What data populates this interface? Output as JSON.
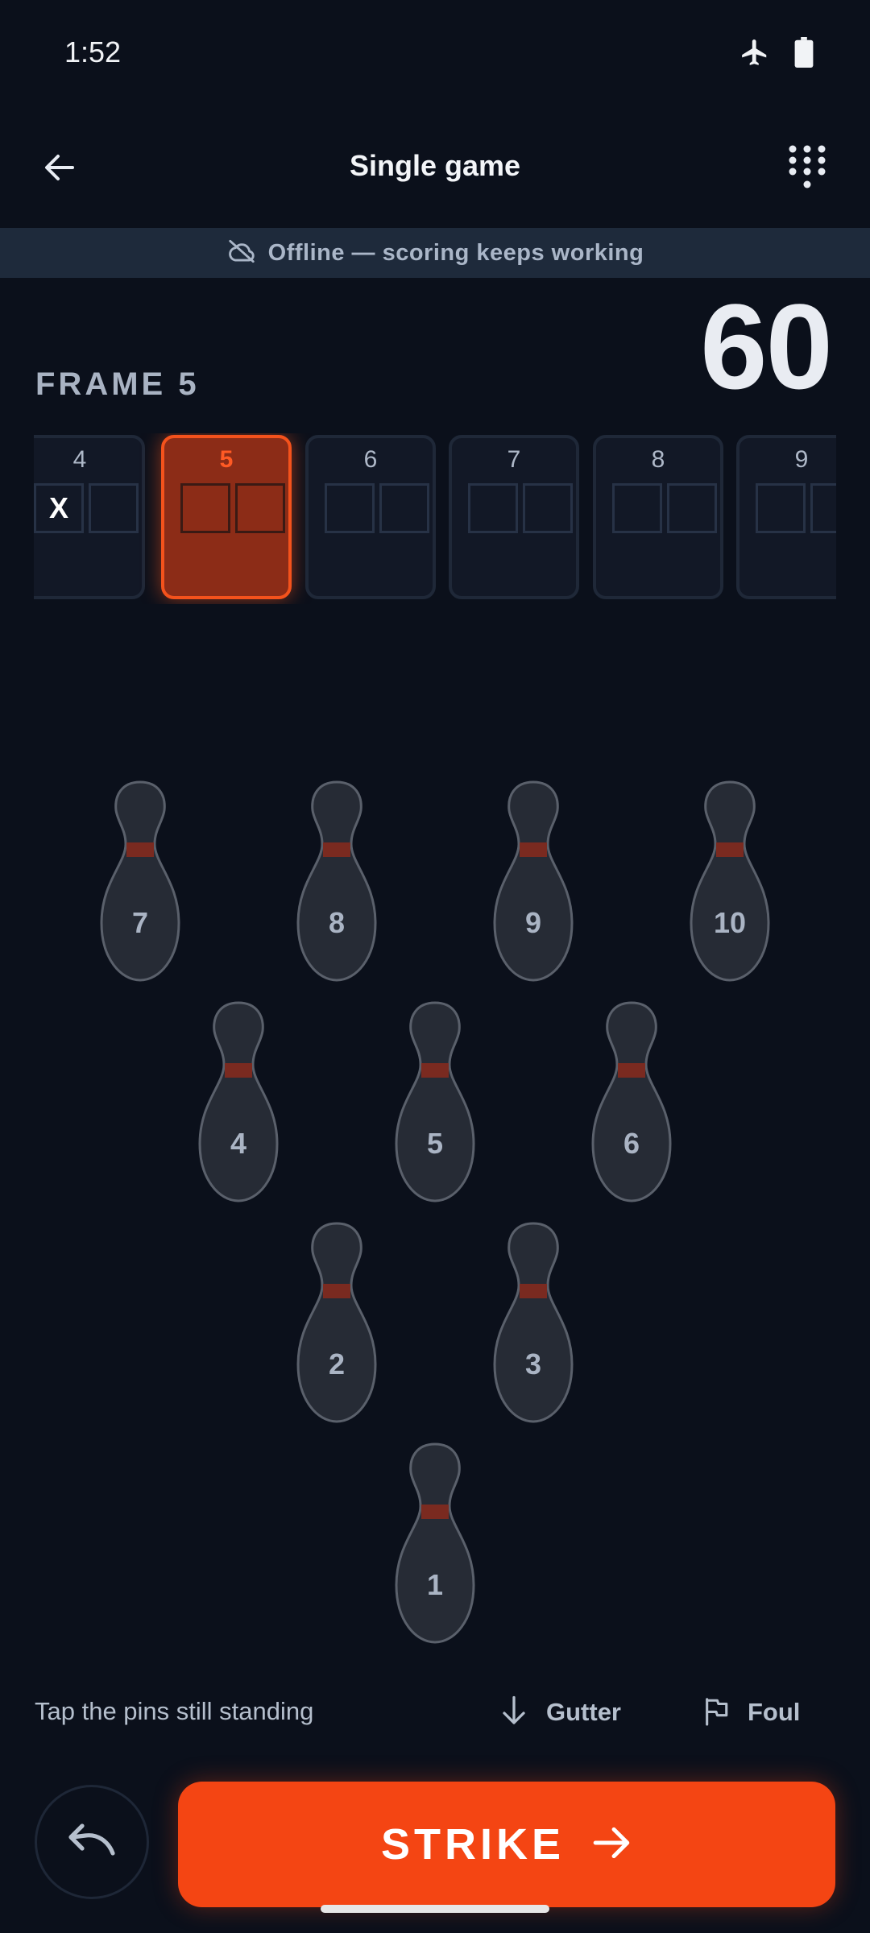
{
  "status_bar": {
    "time": "1:52",
    "icons": [
      "airplane-mode-icon",
      "battery-icon"
    ]
  },
  "app_bar": {
    "title": "Single game",
    "back_icon": "arrow-left-icon",
    "menu_icon": "keypad-icon"
  },
  "banner": {
    "icon": "cloud-off-icon",
    "text": "Offline — scoring keeps working"
  },
  "current_frame_label": "FRAME 5",
  "score": "60",
  "frames": [
    {
      "number": "4",
      "ball1": "X",
      "ball2": "",
      "state": "complete"
    },
    {
      "number": "5",
      "ball1": "",
      "ball2": "",
      "state": "active"
    },
    {
      "number": "6",
      "ball1": "",
      "ball2": "",
      "state": "pending"
    },
    {
      "number": "7",
      "ball1": "",
      "ball2": "",
      "state": "pending"
    },
    {
      "number": "8",
      "ball1": "",
      "ball2": "",
      "state": "pending"
    },
    {
      "number": "9",
      "ball1": "",
      "ball2": "",
      "state": "pending"
    }
  ],
  "pins": [
    {
      "number": "7",
      "standing": true
    },
    {
      "number": "8",
      "standing": true
    },
    {
      "number": "9",
      "standing": true
    },
    {
      "number": "10",
      "standing": true
    },
    {
      "number": "4",
      "standing": true
    },
    {
      "number": "5",
      "standing": true
    },
    {
      "number": "6",
      "standing": true
    },
    {
      "number": "2",
      "standing": true
    },
    {
      "number": "3",
      "standing": true
    },
    {
      "number": "1",
      "standing": true
    }
  ],
  "controls": {
    "hint": "Tap the pins still standing",
    "gutter_label": "Gutter",
    "foul_label": "Foul",
    "strike_label": "STRIKE",
    "undo_icon": "undo-icon"
  },
  "colors": {
    "background": "#0b101b",
    "accent": "#f44513",
    "active_frame_fill": "#8c2c17",
    "pin_fill": "#262b35",
    "pin_stripe": "#7a2a20"
  }
}
